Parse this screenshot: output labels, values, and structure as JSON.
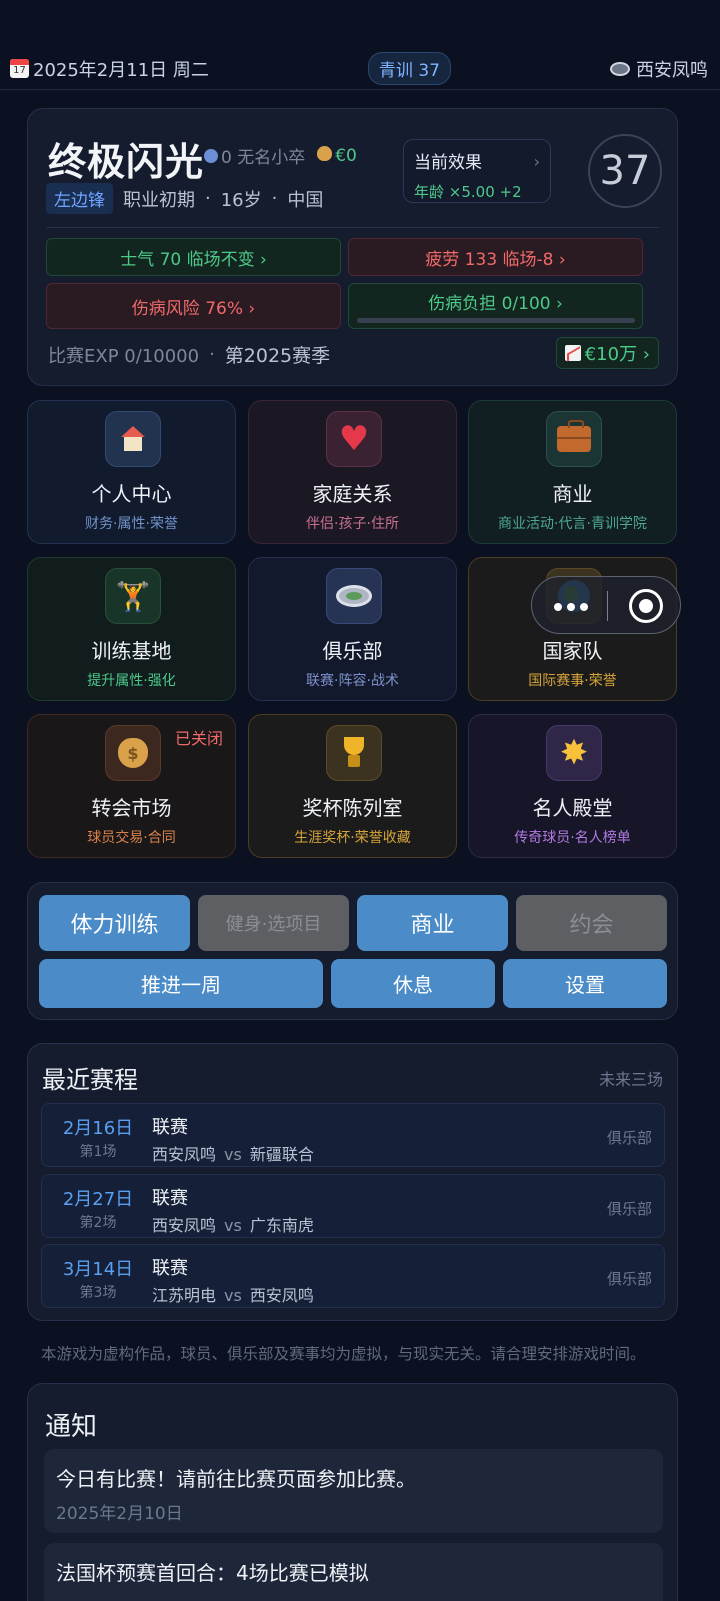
{
  "topbar": {
    "date": "2025年2月11日 周二",
    "youth_badge": "青训 37",
    "club": "西安凤鸣"
  },
  "profile": {
    "name": "终极闪光",
    "fans": "0 无名小卒",
    "money": "€0",
    "effect_title": "当前效果",
    "effect_value": "年龄 ×5.00  +2",
    "level": "37",
    "position": "左边锋",
    "career_stage": "职业初期",
    "age": "16岁",
    "nation": "中国",
    "morale": "士气 70  临场不变 ›",
    "fatigue": "疲劳 133  临场-8 ›",
    "injury_risk": "伤病风险 76% ›",
    "injury_load": "伤病负担 0/100 ›",
    "injury_load_progress_pct": 0,
    "match_exp": "比赛EXP 0/10000",
    "season": "第2025赛季",
    "market_value": "€10万 ›"
  },
  "tiles": [
    {
      "title": "个人中心",
      "sub": "财务·属性·荣誉",
      "icon": "house-icon"
    },
    {
      "title": "家庭关系",
      "sub": "伴侣·孩子·住所",
      "icon": "heart-icon"
    },
    {
      "title": "商业",
      "sub": "商业活动·代言·青训学院",
      "icon": "briefcase-icon"
    },
    {
      "title": "训练基地",
      "sub": "提升属性·强化",
      "icon": "weightlifter-icon"
    },
    {
      "title": "俱乐部",
      "sub": "联赛·阵容·战术",
      "icon": "stadium-icon"
    },
    {
      "title": "国家队",
      "sub": "国际赛事·荣誉",
      "icon": "globe-icon"
    },
    {
      "title": "转会市场",
      "sub": "球员交易·合同",
      "icon": "moneybag-icon",
      "badge": "已关闭"
    },
    {
      "title": "奖杯陈列室",
      "sub": "生涯奖杯·荣誉收藏",
      "icon": "trophy-icon"
    },
    {
      "title": "名人殿堂",
      "sub": "传奇球员·名人榜单",
      "icon": "star-icon"
    }
  ],
  "actions": {
    "stamina_training": "体力训练",
    "fitness_select": "健身·选项目",
    "business": "商业",
    "date": "约会",
    "advance_week": "推进一周",
    "rest": "休息",
    "settings": "设置"
  },
  "schedule": {
    "title": "最近赛程",
    "hint": "未来三场",
    "matches": [
      {
        "date": "2月16日",
        "round": "第1场",
        "type": "联赛",
        "home": "西安凤鸣",
        "vs": "vs",
        "away": "新疆联合",
        "tag": "俱乐部"
      },
      {
        "date": "2月27日",
        "round": "第2场",
        "type": "联赛",
        "home": "西安凤鸣",
        "vs": "vs",
        "away": "广东南虎",
        "tag": "俱乐部"
      },
      {
        "date": "3月14日",
        "round": "第3场",
        "type": "联赛",
        "home": "江苏明电",
        "vs": "vs",
        "away": "西安凤鸣",
        "tag": "俱乐部"
      }
    ]
  },
  "disclaimer": "本游戏为虚构作品，球员、俱乐部及赛事均为虚拟，与现实无关。请合理安排游戏时间。",
  "notice": {
    "title": "通知",
    "items": [
      {
        "text": "今日有比赛！请前往比赛页面参加比赛。",
        "date": "2025年2月10日"
      },
      {
        "text": "法国杯预赛首回合：4场比赛已模拟",
        "date": ""
      }
    ]
  }
}
